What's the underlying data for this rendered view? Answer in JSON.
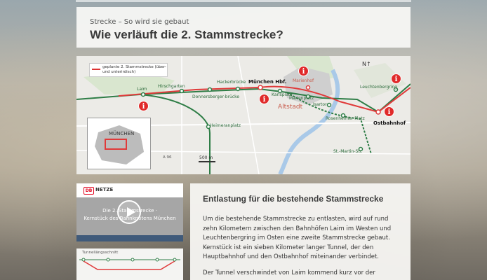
{
  "header": {
    "kicker": "Strecke – So wird sie gebaut",
    "title": "Wie verläuft die 2. Stammstrecke?"
  },
  "map": {
    "legend": "geplante 2. Stammstrecke (über- und unterirdisch)",
    "stations": [
      "Laim",
      "Hirschgarten",
      "Donnersberger-brücke",
      "Hackerbrücke",
      "München Hbf.",
      "Karlsplatz",
      "Marienhof",
      "Marienplatz",
      "Isartor",
      "Rosenheimer Platz",
      "Ostbahnhof",
      "Leuchtenbergring",
      "Heimeranplatz",
      "St.-Martin-Str."
    ],
    "area_label": "Altstadt",
    "inset_label": "MÜNCHEN",
    "road_label": "A 96",
    "scale_label": "500 m",
    "info_icon": "i",
    "north_icon": "north-arrow-icon",
    "colors": {
      "line_red": "#e03a3a",
      "line_green": "#2e7d46",
      "water": "#a9c9e8",
      "park": "#cfe3c5"
    }
  },
  "video": {
    "brand": "DB",
    "brand_name": "NETZE",
    "line1": "Die 2. Stammstrecke ·",
    "line2": "Kernstück des Bahnknotens München"
  },
  "tunnel": {
    "title": "Tunnellängsschnitt"
  },
  "article": {
    "title": "Entlastung für die bestehende Stammstrecke",
    "body": "Um die bestehende Stammstrecke zu entlasten, wird auf rund zehn Kilometern zwischen den Bahnhöfen Laim im Westen und Leuchtenbergring im Osten eine zweite Stammstrecke gebaut. Kernstück ist ein sieben Kilometer langer Tunnel, der den Hauptbahnhof und den Ostbahnhof miteinander verbindet.",
    "body2": "Der Tunnel verschwindet von Laim kommend kurz vor der"
  }
}
